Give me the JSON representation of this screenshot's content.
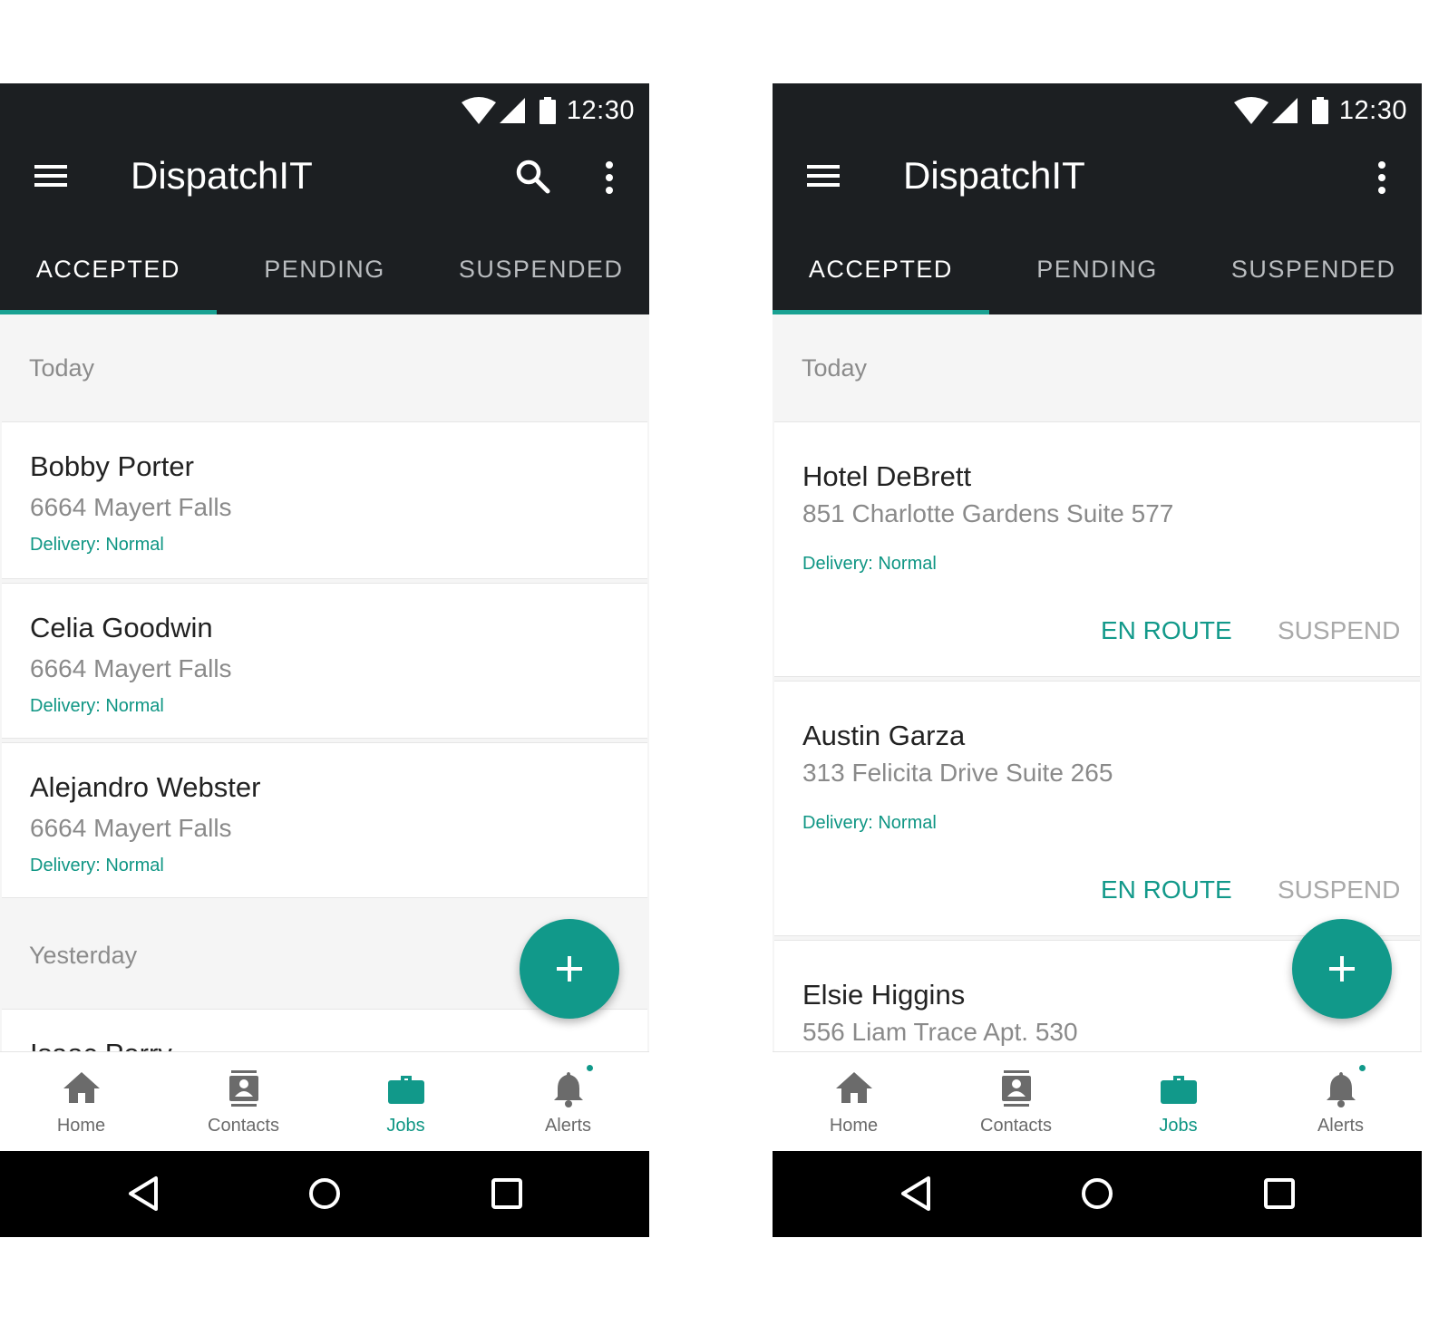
{
  "colors": {
    "appbar": "#1c1f22",
    "accent": "#11998a",
    "background": "#f5f5f5"
  },
  "screens": [
    {
      "status": {
        "time": "12:30",
        "icons": [
          "wifi-icon",
          "signal-icon",
          "battery-icon"
        ]
      },
      "app_title": "DispatchIT",
      "actions": [
        "menu-icon",
        "search-icon",
        "more-vert-icon"
      ],
      "tabs": [
        {
          "label": "ACCEPTED",
          "active": true
        },
        {
          "label": "PENDING",
          "active": false
        },
        {
          "label": "SUSPENDED",
          "active": false
        }
      ],
      "sections": [
        {
          "header": "Today",
          "jobs": [
            {
              "name": "Bobby Porter",
              "address": "6664 Mayert Falls",
              "delivery": "Delivery: Normal"
            },
            {
              "name": "Celia Goodwin",
              "address": "6664 Mayert Falls",
              "delivery": "Delivery: Normal"
            },
            {
              "name": "Alejandro Webster",
              "address": "6664 Mayert Falls",
              "delivery": "Delivery: Normal"
            }
          ]
        },
        {
          "header": "Yesterday",
          "jobs": [
            {
              "name": "Isaac Perry"
            }
          ]
        }
      ],
      "fab_icon": "plus-icon",
      "nav": [
        {
          "label": "Home",
          "icon": "home-icon",
          "active": false
        },
        {
          "label": "Contacts",
          "icon": "contacts-icon",
          "active": false
        },
        {
          "label": "Jobs",
          "icon": "briefcase-icon",
          "active": true
        },
        {
          "label": "Alerts",
          "icon": "bell-icon",
          "active": false,
          "badge": true
        }
      ]
    },
    {
      "status": {
        "time": "12:30",
        "icons": [
          "wifi-icon",
          "signal-icon",
          "battery-icon"
        ]
      },
      "app_title": "DispatchIT",
      "actions": [
        "menu-icon",
        "more-vert-icon"
      ],
      "tabs": [
        {
          "label": "ACCEPTED",
          "active": true
        },
        {
          "label": "PENDING",
          "active": false
        },
        {
          "label": "SUSPENDED",
          "active": false
        }
      ],
      "sections": [
        {
          "header": "Today",
          "jobs": [
            {
              "name": "Hotel DeBrett",
              "address": "851 Charlotte Gardens Suite 577",
              "delivery": "Delivery: Normal",
              "primary_action": "EN ROUTE",
              "secondary_action": "SUSPEND"
            },
            {
              "name": "Austin Garza",
              "address": "313 Felicita Drive Suite 265",
              "delivery": "Delivery: Normal",
              "primary_action": "EN ROUTE",
              "secondary_action": "SUSPEND"
            },
            {
              "name": "Elsie Higgins",
              "address": "556 Liam Trace Apt. 530"
            }
          ]
        }
      ],
      "fab_icon": "plus-icon",
      "nav": [
        {
          "label": "Home",
          "icon": "home-icon",
          "active": false
        },
        {
          "label": "Contacts",
          "icon": "contacts-icon",
          "active": false
        },
        {
          "label": "Jobs",
          "icon": "briefcase-icon",
          "active": true
        },
        {
          "label": "Alerts",
          "icon": "bell-icon",
          "active": false,
          "badge": true
        }
      ]
    }
  ]
}
